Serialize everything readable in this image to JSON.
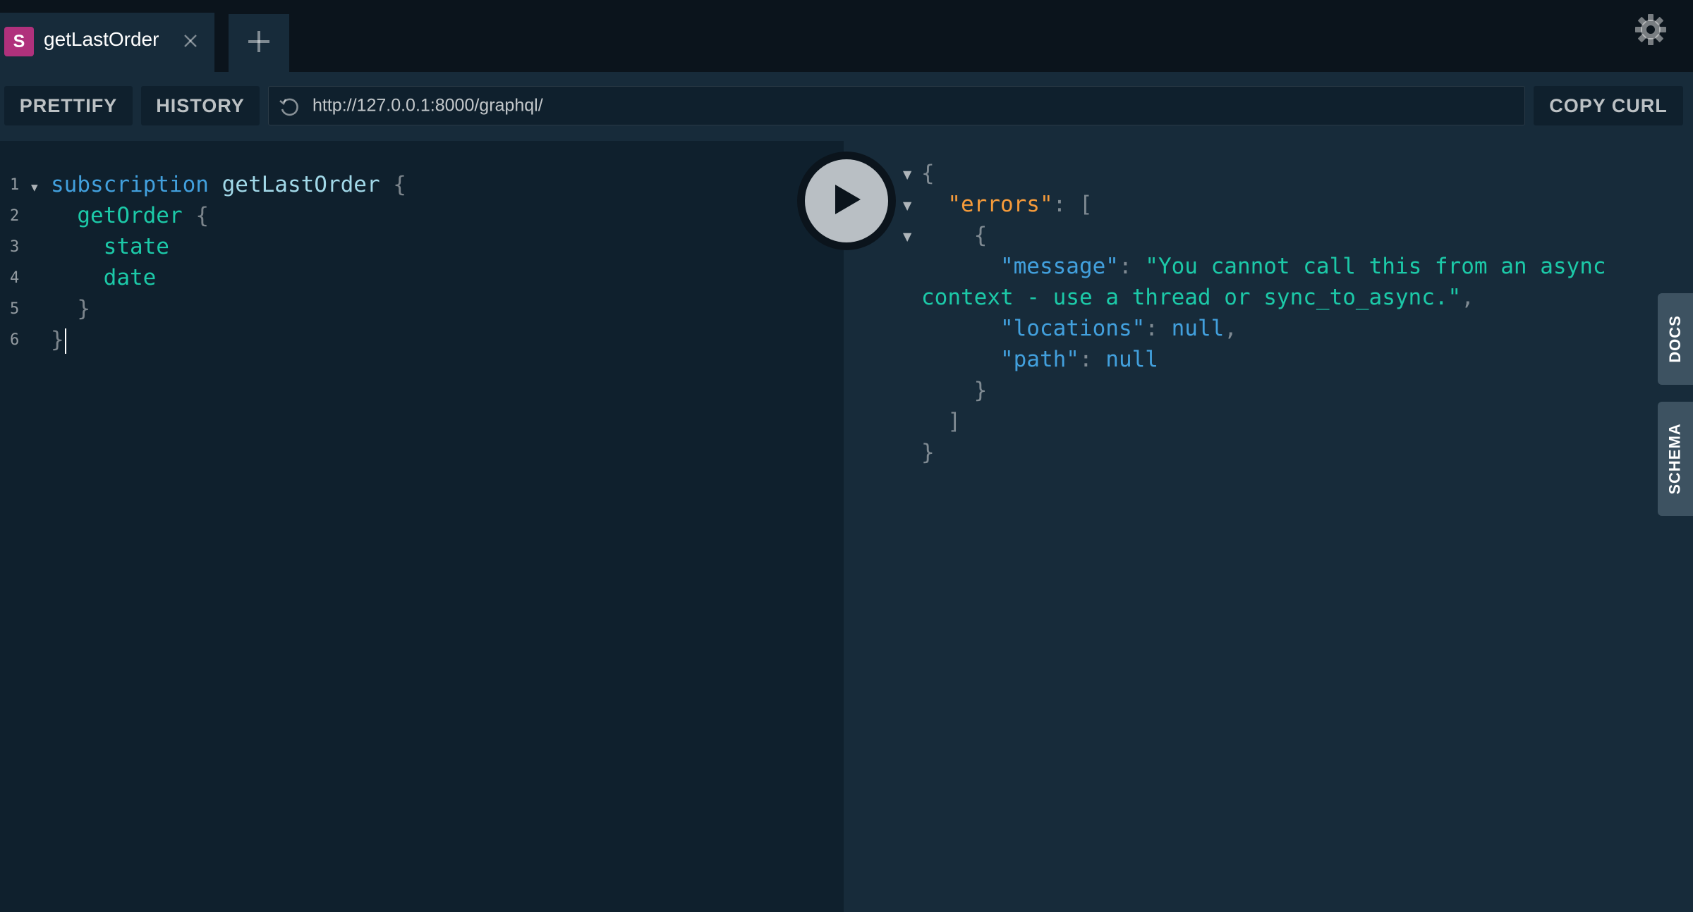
{
  "tabs": [
    {
      "badge": "S",
      "title": "getLastOrder"
    }
  ],
  "toolbar": {
    "prettify_label": "PRETTIFY",
    "history_label": "HISTORY",
    "endpoint_url": "http://127.0.0.1:8000/graphql/",
    "copy_curl_label": "COPY CURL"
  },
  "editor": {
    "line_numbers": [
      "1",
      "2",
      "3",
      "4",
      "5",
      "6"
    ],
    "query_keyword": "subscription",
    "operation_name": "getLastOrder",
    "field_root": "getOrder",
    "field_1": "state",
    "field_2": "date",
    "open_brace": "{",
    "close_brace": "}"
  },
  "result": {
    "open_brace": "{",
    "errors_key": "\"errors\"",
    "colon_bracket": ": [",
    "inner_open": "{",
    "message_key": "\"message\"",
    "message_value_part1": "\"You cannot call this from an async",
    "message_value_part2": "context - use a thread or sync_to_async.\"",
    "locations_key": "\"locations\"",
    "locations_value": "null",
    "path_key": "\"path\"",
    "path_value": "null",
    "inner_close": "}",
    "array_close": "]",
    "close_brace": "}"
  },
  "side_tabs": {
    "docs_label": "DOCS",
    "schema_label": "SCHEMA"
  },
  "icons": {
    "close": "close-icon",
    "add": "plus-icon",
    "settings": "gear-icon",
    "reload": "reload-icon",
    "run": "play-icon"
  },
  "colors": {
    "badge": "#b0317c",
    "keyword": "#42a0dd",
    "field": "#1cc9a8",
    "errors_key": "#f69b3a"
  }
}
